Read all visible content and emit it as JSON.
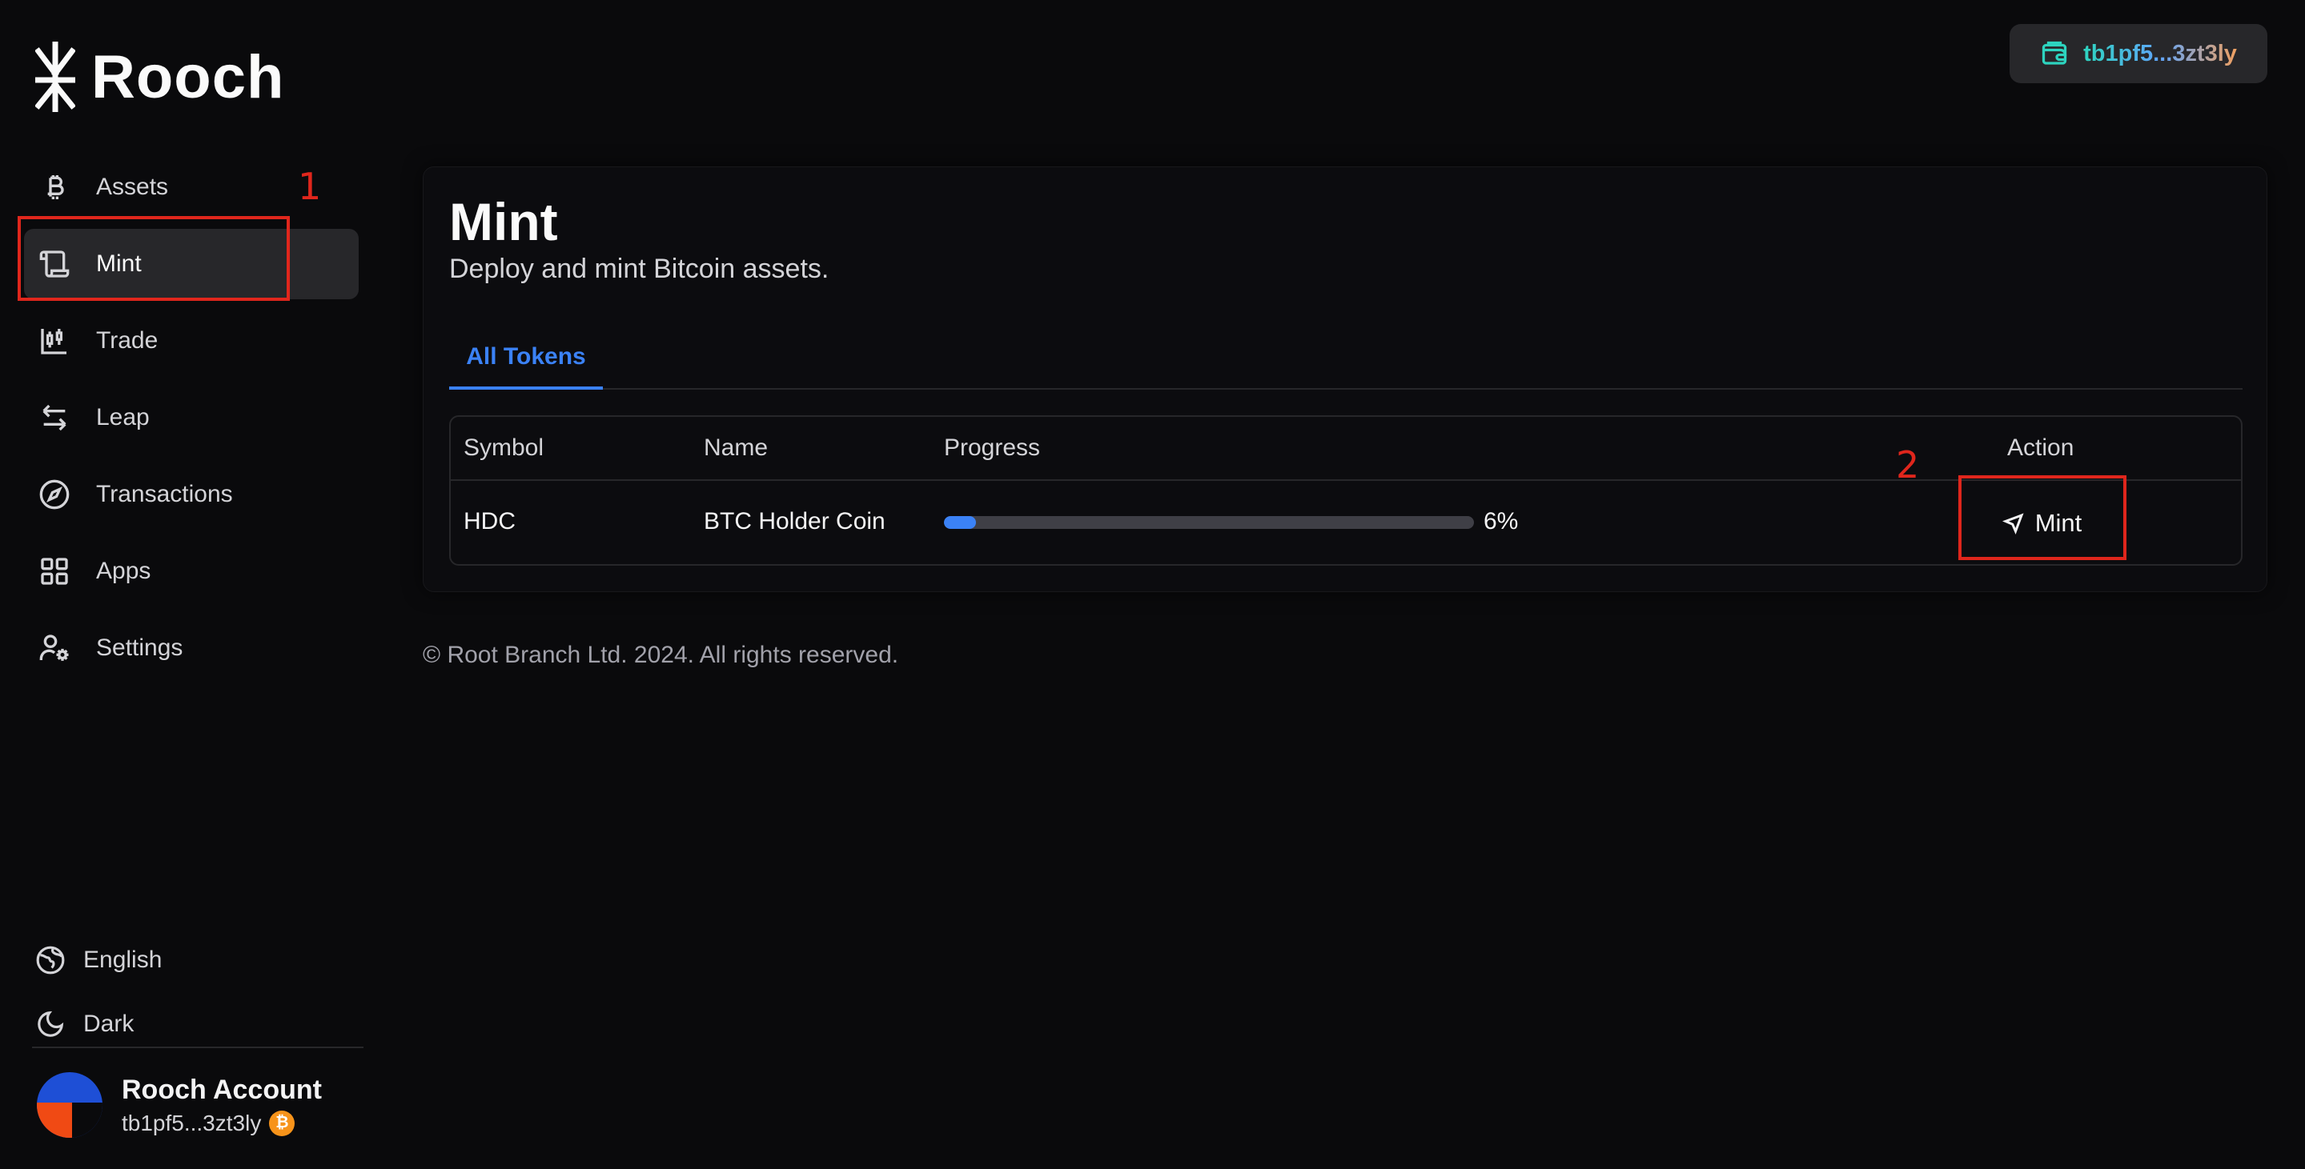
{
  "app": {
    "name": "Rooch"
  },
  "sidebar": {
    "items": [
      {
        "label": "Assets",
        "icon": "bitcoin-icon",
        "active": false
      },
      {
        "label": "Mint",
        "icon": "scroll-icon",
        "active": true
      },
      {
        "label": "Trade",
        "icon": "chart-candles-icon",
        "active": false
      },
      {
        "label": "Leap",
        "icon": "swap-arrows-icon",
        "active": false
      },
      {
        "label": "Transactions",
        "icon": "compass-icon",
        "active": false
      },
      {
        "label": "Apps",
        "icon": "grid-icon",
        "active": false
      },
      {
        "label": "Settings",
        "icon": "user-settings-icon",
        "active": false
      }
    ],
    "language": "English",
    "theme": "Dark",
    "account": {
      "name": "Rooch Account",
      "address": "tb1pf5...3zt3ly",
      "badge": "₿"
    }
  },
  "header": {
    "wallet_address": "tb1pf5...3zt3ly"
  },
  "main": {
    "title": "Mint",
    "subtitle": "Deploy and mint Bitcoin assets.",
    "tabs": [
      {
        "label": "All Tokens",
        "active": true
      }
    ],
    "table": {
      "columns": [
        "Symbol",
        "Name",
        "Progress",
        "Action"
      ],
      "rows": [
        {
          "symbol": "HDC",
          "name": "BTC Holder Coin",
          "progress": 6,
          "progress_label": "6%",
          "action": "Mint"
        }
      ]
    }
  },
  "annotations": {
    "first": "1",
    "second": "2",
    "color": "#e0261c"
  },
  "footer": {
    "text": "© Root Branch Ltd. 2024. All rights reserved."
  },
  "colors": {
    "accent": "#3b82f6",
    "background": "#0a0a0c",
    "active_nav": "#27272a"
  }
}
